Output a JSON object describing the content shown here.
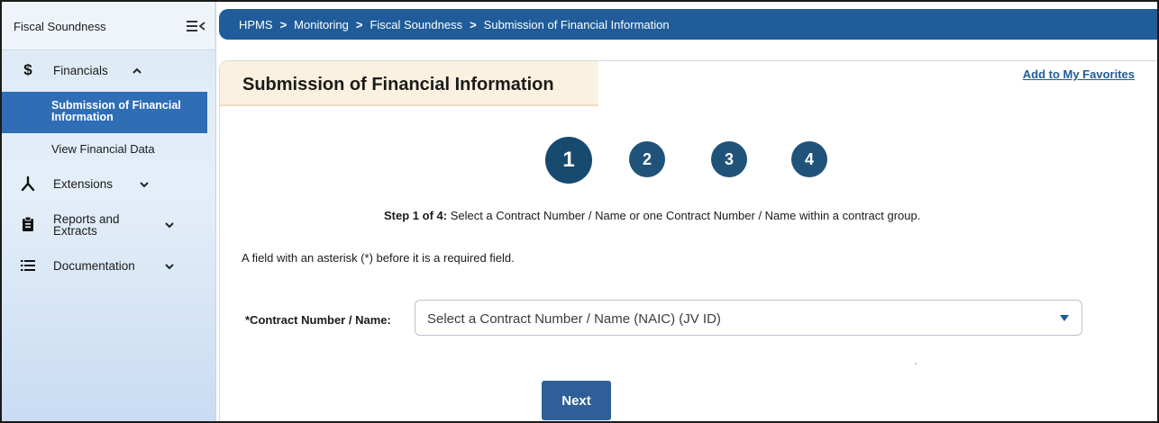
{
  "sidebar": {
    "title": "Fiscal Soundness",
    "items": [
      {
        "icon": "dollar-icon",
        "label": "Financials",
        "expanded": true
      },
      {
        "icon": "split-arrow-icon",
        "label": "Extensions",
        "expanded": false
      },
      {
        "icon": "clipboard-icon",
        "label_line1": "Reports and",
        "label_line2": "Extracts",
        "expanded": false
      },
      {
        "icon": "list-icon",
        "label": "Documentation",
        "expanded": false
      }
    ],
    "submenu": {
      "active_line1": "Submission of Financial",
      "active_line2": "Information",
      "other": "View Financial Data"
    }
  },
  "breadcrumb": [
    "HPMS",
    "Monitoring",
    "Fiscal Soundness",
    "Submission of Financial Information"
  ],
  "page": {
    "title": "Submission of Financial Information",
    "favorites_link": "Add to My Favorites",
    "steps": [
      "1",
      "2",
      "3",
      "4"
    ],
    "current_step": 1,
    "step_prefix": "Step 1 of 4:",
    "step_instruction": " Select a Contract Number / Name or one Contract Number / Name within a contract group.",
    "required_note": "A field with an asterisk (*) before it is a required field.",
    "contract_label": "*Contract Number / Name:",
    "contract_placeholder": "Select a Contract Number / Name (NAIC) (JV ID)",
    "next_label": "Next"
  },
  "colors": {
    "topbar": "#1f5c99",
    "active_item": "#2f6db5",
    "step_circle": "#1f5379",
    "title_box": "#fbf1e0",
    "next_button": "#2f5f98"
  }
}
